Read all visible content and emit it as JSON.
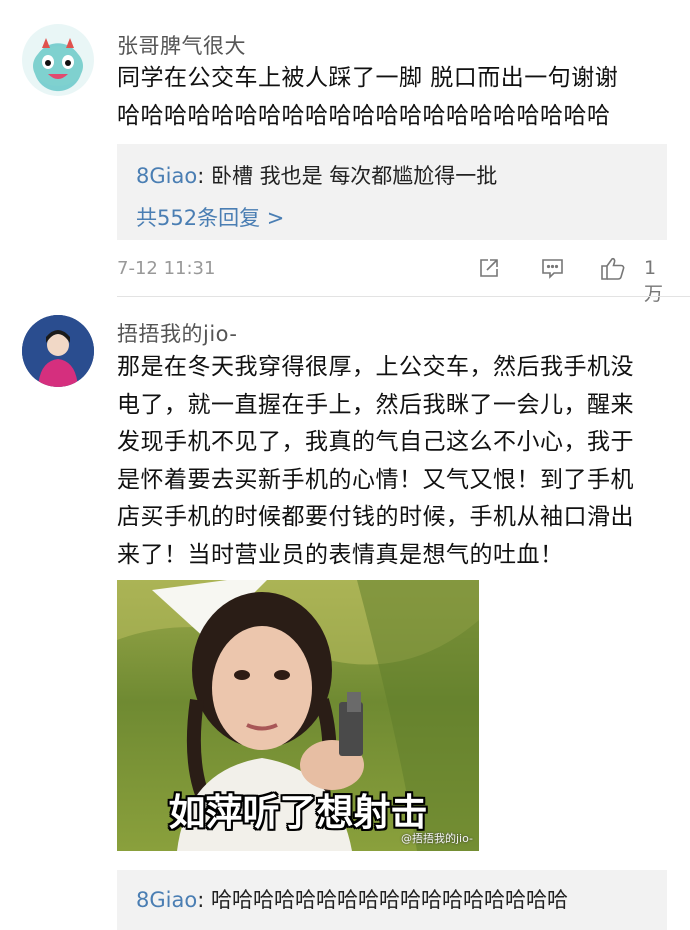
{
  "comments": [
    {
      "username": "张哥脾气很大",
      "text_lines": [
        "同学在公交车上被人踩了一脚 脱口而出一句谢谢",
        "哈哈哈哈哈哈哈哈哈哈哈哈哈哈哈哈哈哈哈哈哈"
      ],
      "reply": {
        "user": "8Giao",
        "text": "卧槽 我也是 每次都尴尬得一批"
      },
      "reply_count_label": "共552条回复 >",
      "time": "7-12 11:31",
      "likes": "1万",
      "icons": {
        "share": "share-icon",
        "comment": "comment-icon",
        "like": "thumbs-up-icon"
      }
    },
    {
      "username": "捂捂我的jio-",
      "text_lines": [
        "那是在冬天我穿得很厚，上公交车，然后我手机没",
        "电了，就一直握在手上，然后我眯了一会儿，醒来",
        "发现手机不见了，我真的气自己这么不小心，我于",
        "是怀着要去买新手机的心情！又气又恨！到了手机",
        "店买手机的时候都要付钱的时候，手机从袖口滑出",
        "来了！当时营业员的表情真是想气的吐血！"
      ],
      "image_caption": "如萍听了想射击",
      "image_watermark": "@捂捂我的jio-",
      "reply": {
        "user": "8Giao",
        "text": "哈哈哈哈哈哈哈哈哈哈哈哈哈哈哈哈哈"
      }
    }
  ],
  "colors": {
    "link": "#4a7eb3",
    "reply_bg": "#f2f2f2",
    "meta": "#999999"
  }
}
